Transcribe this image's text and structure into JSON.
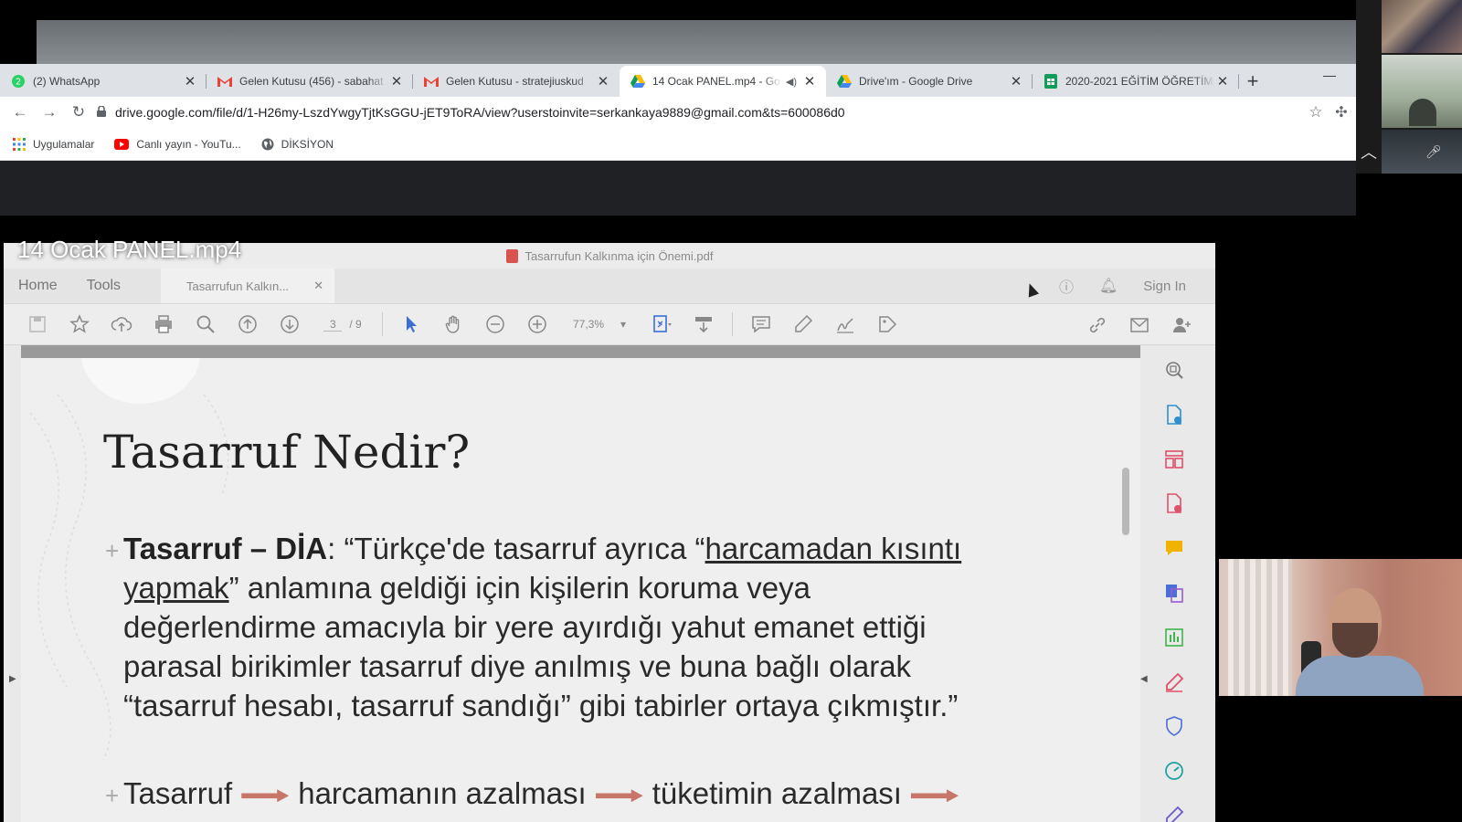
{
  "browser": {
    "tabs": [
      {
        "label": "(2) WhatsApp",
        "icon": "whatsapp-icon"
      },
      {
        "label": "Gelen Kutusu (456) - sabahat",
        "icon": "gmail-icon"
      },
      {
        "label": "Gelen Kutusu - stratejiuskud",
        "icon": "gmail-icon"
      },
      {
        "label": "14 Ocak PANEL.mp4 - Go",
        "icon": "google-drive-icon",
        "active": true,
        "audio": true
      },
      {
        "label": "Drive'ım - Google Drive",
        "icon": "google-drive-icon"
      },
      {
        "label": "2020-2021 EĞİTİM ÖĞRETİM",
        "icon": "google-sheets-icon"
      }
    ],
    "url": "drive.google.com/file/d/1-H26my-LszdYwgyTjtKsGGU-jET9ToRA/view?userstoinvite=serkankaya9889@gmail.com&ts=600086d0",
    "bookmarks": [
      {
        "label": "Uygulamalar",
        "icon": "apps-grid-icon"
      },
      {
        "label": "Canlı yayın - YouTu...",
        "icon": "youtube-icon"
      },
      {
        "label": "DİKSİYON",
        "icon": "globe-icon"
      }
    ]
  },
  "video": {
    "title": "14 Ocak PANEL.mp4"
  },
  "acrobat": {
    "window_title": "Tasarrufun Kalkınma için Önemi.pdf",
    "menu": {
      "home": "Home",
      "tools": "Tools"
    },
    "doc_tab": "Tasarrufun Kalkın...",
    "sign_in": "Sign In",
    "page_current": "3",
    "page_total": "/ 9",
    "zoom": "77,3%"
  },
  "slide": {
    "title": "Tasarruf Nedir?",
    "p1_bold": "Tasarruf – DİA",
    "p1_a": ": “Türkçe'de tasarruf ayrıca “",
    "p1_u": "harcamadan kısıntı",
    "p1_u2": "yapmak",
    "p1_b": "” anlamına geldiği için kişilerin koruma veya",
    "p1_c": "değerlendirme amacıyla bir yere ayırdığı yahut emanet ettiği",
    "p1_d": "parasal birikimler tasarruf diye anılmış ve buna bağlı olarak",
    "p1_e": "“tasarruf hesabı, tasarruf sandığı” gibi tabirler ortaya çıkmıştır.”",
    "p2_a": "Tasarruf",
    "p2_b": "harcamanın azalması",
    "p2_c": "tüketimin azalması"
  },
  "colors": {
    "arrow": "#c8756a",
    "tab_bg": "#dee1e6",
    "dark_band": "#202124"
  }
}
